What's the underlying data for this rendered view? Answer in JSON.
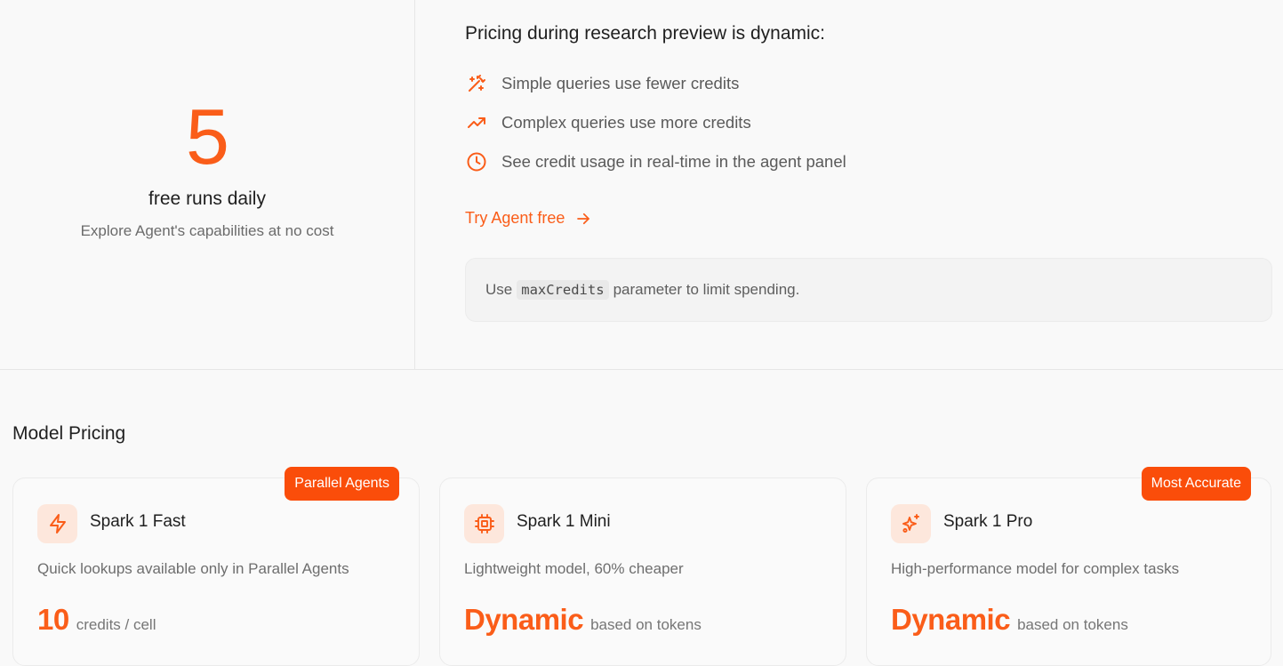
{
  "free_runs": {
    "count": "5",
    "label": "free runs daily",
    "subtitle": "Explore Agent's capabilities at no cost"
  },
  "pricing": {
    "title": "Pricing during research preview is dynamic:",
    "features": [
      {
        "icon": "magic-wand-icon",
        "text": "Simple queries use fewer credits"
      },
      {
        "icon": "trending-up-icon",
        "text": "Complex queries use more credits"
      },
      {
        "icon": "clock-icon",
        "text": "See credit usage in real-time in the agent panel"
      }
    ],
    "cta_label": "Try Agent free",
    "note": {
      "prefix": "Use",
      "code": "maxCredits",
      "suffix": "parameter to limit spending."
    }
  },
  "model_pricing": {
    "title": "Model Pricing",
    "accent_color": "#fa5d19",
    "cards": [
      {
        "badge": "Parallel Agents",
        "icon": "lightning-icon",
        "name": "Spark 1 Fast",
        "description": "Quick lookups available only in Parallel Agents",
        "price": "10",
        "price_unit": "credits / cell"
      },
      {
        "badge": "",
        "icon": "cpu-chip-icon",
        "name": "Spark 1 Mini",
        "description": "Lightweight model, 60% cheaper",
        "price": "Dynamic",
        "price_unit": "based on tokens"
      },
      {
        "badge": "Most Accurate",
        "icon": "sparkles-icon",
        "name": "Spark 1 Pro",
        "description": "High-performance model for complex tasks",
        "price": "Dynamic",
        "price_unit": "based on tokens"
      }
    ]
  }
}
